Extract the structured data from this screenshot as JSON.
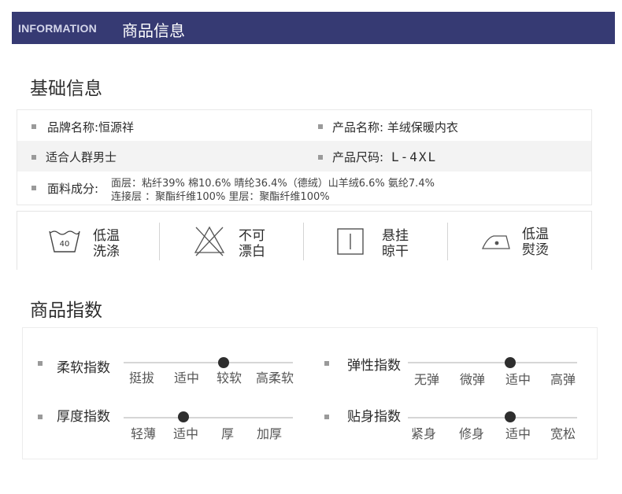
{
  "header": {
    "en": "INFORMATION",
    "cn": "商品信息"
  },
  "basic": {
    "title": "基础信息",
    "brand": "品牌名称:恒源祥",
    "product_name": "产品名称: 羊绒保暖内衣",
    "audience": "适合人群男士",
    "size_label": "产品尺码:",
    "size_value": "L-4XL",
    "fabric_label": "面料成分:",
    "fabric_line1": "面层：粘纤39% 棉10.6% 晴纶36.4%（德绒）山羊绒6.6% 氨纶7.4%",
    "fabric_line2": "连接层 ：聚酯纤维100% 里层：聚酯纤维100%"
  },
  "care": [
    {
      "icon": "wash-40-icon",
      "num": "40",
      "l1": "低温",
      "l2": "洗涤"
    },
    {
      "icon": "no-bleach-icon",
      "l1": "不可",
      "l2": "漂白"
    },
    {
      "icon": "hang-dry-icon",
      "l1": "悬挂",
      "l2": "晾干"
    },
    {
      "icon": "iron-low-icon",
      "l1": "低温",
      "l2": "熨烫"
    }
  ],
  "index": {
    "title": "商品指数",
    "items": [
      {
        "label": "柔软指数",
        "levels": [
          "挺拔",
          "适中",
          "较软",
          "高柔软"
        ],
        "selected": "较软"
      },
      {
        "label": "弹性指数",
        "levels": [
          "无弹",
          "微弹",
          "适中",
          "高弹"
        ],
        "selected": "适中"
      },
      {
        "label": "厚度指数",
        "levels": [
          "轻薄",
          "适中",
          "厚",
          "加厚"
        ],
        "selected": "适中"
      },
      {
        "label": "贴身指数",
        "levels": [
          "紧身",
          "修身",
          "适中",
          "宽松"
        ],
        "selected": "适中"
      }
    ]
  }
}
